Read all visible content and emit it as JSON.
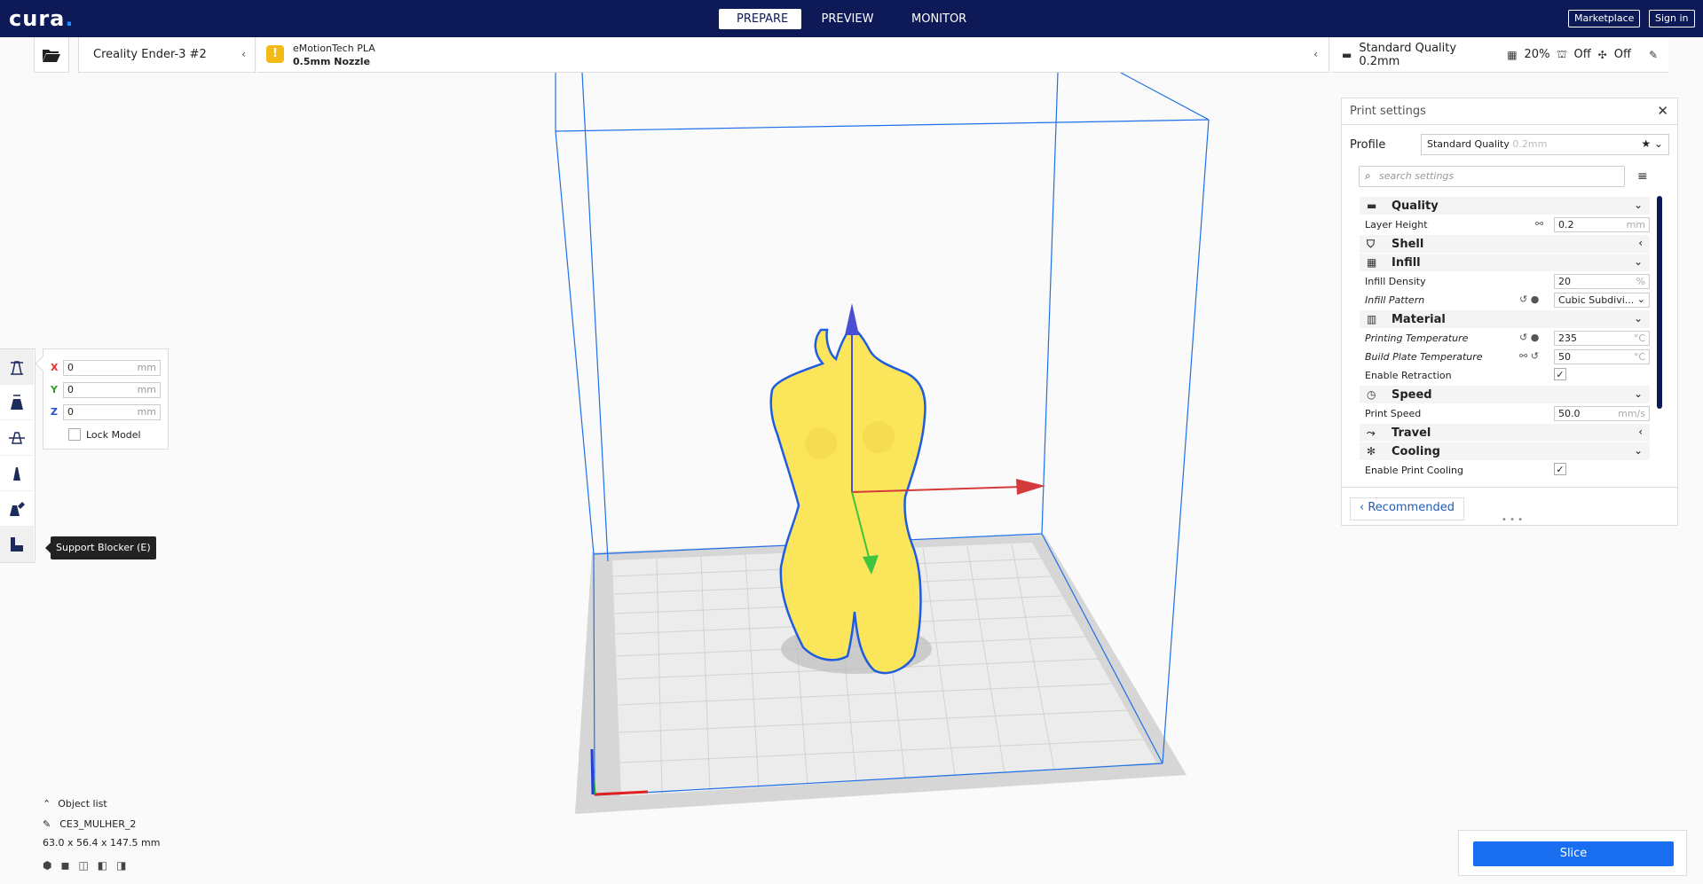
{
  "app": {
    "logo": "cura",
    "logo_dot": "."
  },
  "stages": [
    {
      "label": "PREPARE",
      "active": true
    },
    {
      "label": "PREVIEW",
      "active": false
    },
    {
      "label": "MONITOR",
      "active": false
    }
  ],
  "header": {
    "marketplace": "Marketplace",
    "signin": "Sign in"
  },
  "printer": {
    "name": "Creality Ender-3 #2"
  },
  "material": {
    "name": "eMotionTech PLA",
    "nozzle": "0.5mm Nozzle",
    "warning": "!"
  },
  "settings_summary": {
    "profile": "Standard Quality 0.2mm",
    "infill": "20%",
    "support": "Off",
    "adhesion": "Off"
  },
  "move_tool": {
    "x": {
      "label": "X",
      "value": "0",
      "unit": "mm",
      "color": "#e03030"
    },
    "y": {
      "label": "Y",
      "value": "0",
      "unit": "mm",
      "color": "#2aa02a"
    },
    "z": {
      "label": "Z",
      "value": "0",
      "unit": "mm",
      "color": "#1f4fd1"
    },
    "lock_label": "Lock Model"
  },
  "tooltip": "Support Blocker (E)",
  "print_settings": {
    "title": "Print settings",
    "profile_label": "Profile",
    "profile_value": "Standard Quality",
    "profile_suffix": "0.2mm",
    "search_placeholder": "search settings",
    "categories": {
      "quality": "Quality",
      "shell": "Shell",
      "infill": "Infill",
      "material": "Material",
      "speed": "Speed",
      "travel": "Travel",
      "cooling": "Cooling"
    },
    "rows": {
      "layer_height": {
        "label": "Layer Height",
        "value": "0.2",
        "unit": "mm"
      },
      "infill_density": {
        "label": "Infill Density",
        "value": "20",
        "unit": "%"
      },
      "infill_pattern": {
        "label": "Infill Pattern",
        "value": "Cubic Subdivi..."
      },
      "print_temp": {
        "label": "Printing Temperature",
        "value": "235",
        "unit": "°C"
      },
      "bed_temp": {
        "label": "Build Plate Temperature",
        "value": "50",
        "unit": "°C"
      },
      "retraction": {
        "label": "Enable Retraction"
      },
      "print_speed": {
        "label": "Print Speed",
        "value": "50.0",
        "unit": "mm/s"
      },
      "cooling": {
        "label": "Enable Print Cooling"
      }
    },
    "recommended": "Recommended"
  },
  "object_list": {
    "header": "Object list",
    "object_name": "CE3_MULHER_2",
    "dimensions": "63.0 x 56.4 x 147.5 mm"
  },
  "slice_label": "Slice"
}
